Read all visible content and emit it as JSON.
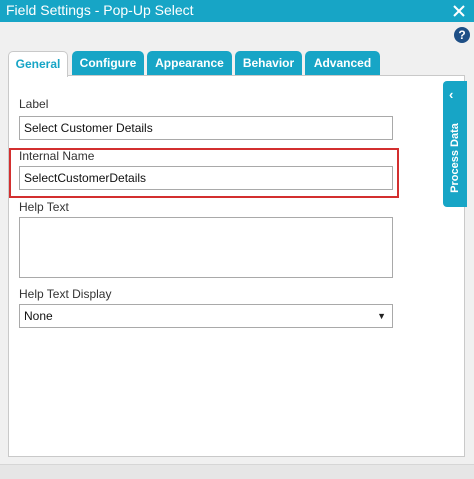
{
  "window": {
    "title": "Field Settings - Pop-Up Select",
    "close_icon": "close-icon",
    "help_label": "?"
  },
  "tabs": [
    {
      "label": "General",
      "active": true
    },
    {
      "label": "Configure",
      "active": false
    },
    {
      "label": "Appearance",
      "active": false
    },
    {
      "label": "Behavior",
      "active": false
    },
    {
      "label": "Advanced",
      "active": false
    }
  ],
  "form": {
    "label": {
      "caption": "Label",
      "value": "Select Customer Details"
    },
    "internal_name": {
      "caption": "Internal Name",
      "value": "SelectCustomerDetails"
    },
    "help_text": {
      "caption": "Help Text",
      "value": ""
    },
    "help_text_display": {
      "caption": "Help Text Display",
      "value": "None"
    }
  },
  "side_panel": {
    "label": "Process Data"
  },
  "colors": {
    "accent": "#17a5c6",
    "highlight": "#d32f2f",
    "help": "#1e4f86"
  }
}
